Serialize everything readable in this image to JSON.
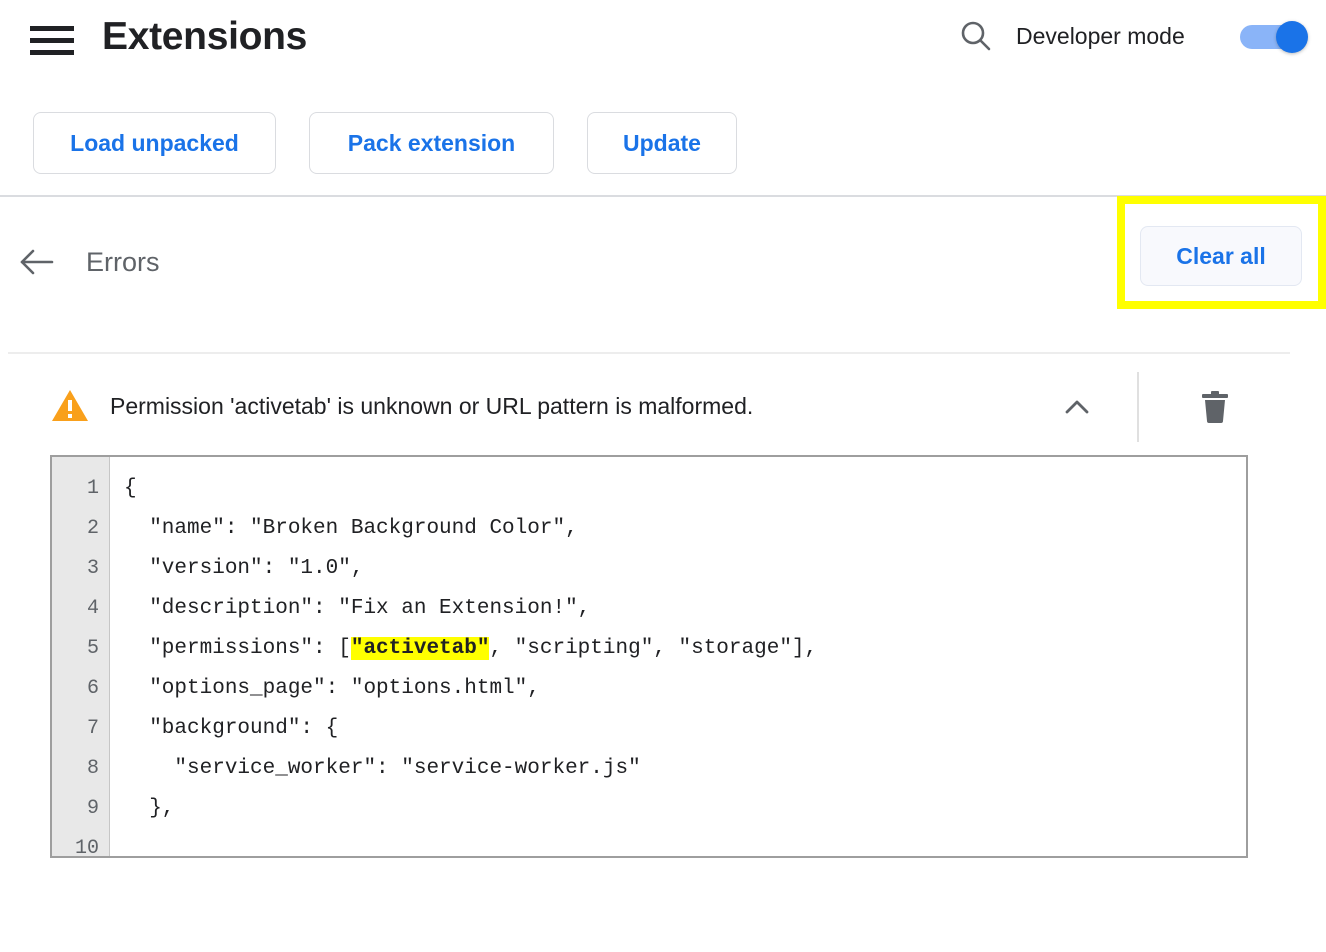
{
  "header": {
    "menu_icon": "hamburger-menu-icon",
    "title": "Extensions",
    "search_icon": "search-icon",
    "developer_mode_label": "Developer mode",
    "developer_mode_enabled": true
  },
  "toolbar": {
    "load_unpacked_label": "Load unpacked",
    "pack_extension_label": "Pack extension",
    "update_label": "Update"
  },
  "errors_page": {
    "back_icon": "back-arrow-icon",
    "title": "Errors",
    "clear_all_label": "Clear all",
    "highlight_color": "#ffff00"
  },
  "error_item": {
    "warning_icon": "warning-triangle-icon",
    "warning_color": "#f9a825",
    "message": "Permission 'activetab' is unknown or URL pattern is malformed.",
    "collapse_icon": "chevron-up-icon",
    "delete_icon": "trash-icon"
  },
  "code_view": {
    "line_numbers": [
      "1",
      "2",
      "3",
      "4",
      "5",
      "6",
      "7",
      "8",
      "9",
      "10"
    ],
    "lines": [
      {
        "pre": "{",
        "highlight": "",
        "post": ""
      },
      {
        "pre": "  \"name\": \"Broken Background Color\",",
        "highlight": "",
        "post": ""
      },
      {
        "pre": "  \"version\": \"1.0\",",
        "highlight": "",
        "post": ""
      },
      {
        "pre": "  \"description\": \"Fix an Extension!\",",
        "highlight": "",
        "post": ""
      },
      {
        "pre": "  \"permissions\": [",
        "highlight": "\"activetab\"",
        "post": ", \"scripting\", \"storage\"],"
      },
      {
        "pre": "  \"options_page\": \"options.html\",",
        "highlight": "",
        "post": ""
      },
      {
        "pre": "  \"background\": {",
        "highlight": "",
        "post": ""
      },
      {
        "pre": "    \"service_worker\": \"service-worker.js\"",
        "highlight": "",
        "post": ""
      },
      {
        "pre": "  },",
        "highlight": "",
        "post": ""
      },
      {
        "pre": "",
        "highlight": "",
        "post": ""
      }
    ],
    "highlight_color": "#ffff00"
  }
}
